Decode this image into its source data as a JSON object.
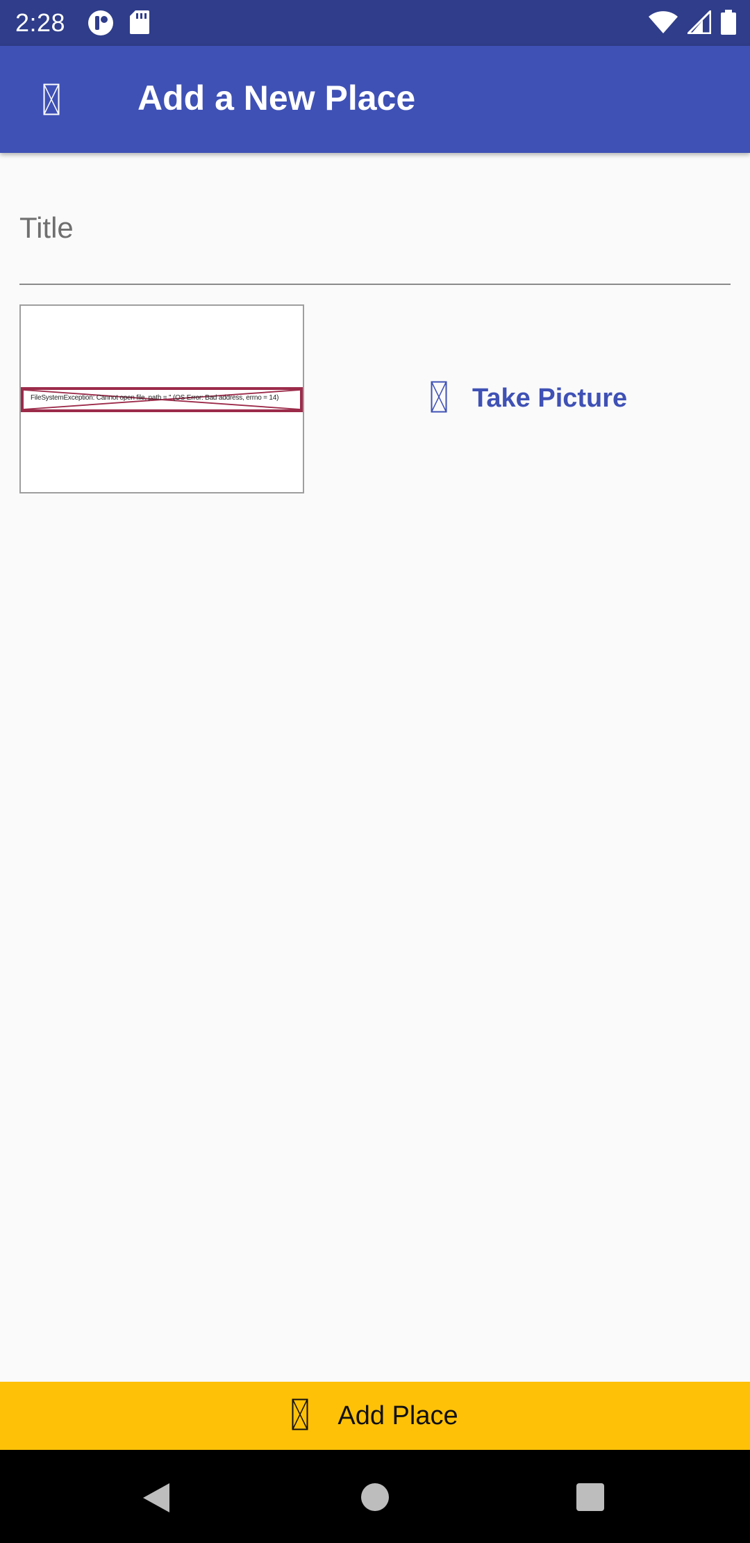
{
  "status_bar": {
    "time": "2:28",
    "left_icons": [
      "notification-app-icon",
      "sd-card-icon"
    ],
    "right_icons": [
      "wifi-icon",
      "cellular-signal-icon",
      "battery-icon"
    ]
  },
  "app_bar": {
    "back_icon": "missing-glyph-icon",
    "title": "Add a New Place"
  },
  "form": {
    "title_placeholder": "Title",
    "title_value": ""
  },
  "image_preview": {
    "error_text": "FileSystemException: Cannot open file, path = '' (OS Error: Bad address, errno = 14)"
  },
  "take_picture": {
    "icon": "missing-glyph-icon",
    "label": "Take Picture"
  },
  "add_place": {
    "icon": "missing-glyph-icon",
    "label": "Add Place"
  },
  "nav_bar": {
    "buttons": [
      "back",
      "home",
      "recents"
    ]
  },
  "colors": {
    "status_bar": "#2f3d8a",
    "app_bar": "#3f51b5",
    "accent_text": "#3f51b5",
    "add_button": "#ffc107",
    "error_border": "#9c2b4a",
    "background": "#fafafa"
  }
}
